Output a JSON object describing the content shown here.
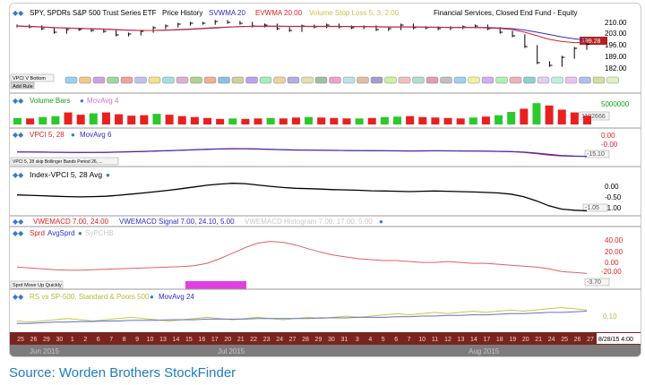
{
  "source_caption": "Source: Worden Brothers StockFinder",
  "panels": {
    "price": {
      "legend": [
        {
          "text": "SPY, SPDRs S&P 500 Trust Series ETF",
          "color": "#000000"
        },
        {
          "text": "Price History",
          "color": "#000000"
        },
        {
          "text": "SVWMA 20",
          "color": "#2b2bd0"
        },
        {
          "text": "EVWMA 20.00",
          "color": "#e02020"
        },
        {
          "text": "Volume Stop Loss 5, 3, 2.00",
          "color": "#e8e060"
        },
        {
          "text": "Financial Services, Closed End Fund - Equity",
          "color": "#000000"
        }
      ],
      "ticks": [
        "210.00",
        "203.00",
        "196.00",
        "189.00",
        "182.00"
      ],
      "last_value": "199.28",
      "small_labels": [
        "VPCI V Bottom",
        "Add Rule"
      ]
    },
    "volume": {
      "legend": [
        {
          "text": "Volume Bars",
          "color": "#16a016"
        },
        {
          "text": "MovAvg 4",
          "color": "#d070d0"
        }
      ],
      "ticks": [
        "5000000"
      ],
      "last_value": "1102666"
    },
    "vpci": {
      "legend": [
        {
          "text": "VPCI 5, 28",
          "color": "#e02020"
        },
        {
          "text": "MovAvg 6",
          "color": "#2b2bd0"
        }
      ],
      "ticks": [
        "0.00",
        "-0.00"
      ],
      "last_value": "-15.10",
      "small_labels": [
        "VPCI 5, 28 skip Bollinger Bands Period 26, ..."
      ]
    },
    "index_vpci": {
      "legend": [
        {
          "text": "Index-VPCI 5, 28 Avg",
          "color": "#000000"
        }
      ],
      "ticks": [
        "0.00",
        "-0.50",
        "-1.00"
      ],
      "last_value": "-1.05"
    },
    "vwemacd": {
      "legend": [
        {
          "text": "VWEMACD 7.00, 24.00",
          "color": "#e02020"
        },
        {
          "text": "VWEMACD Signal 7.00, 24.10, 5.00",
          "color": "#2b2bd0"
        },
        {
          "text": "VWEMACD Histogram 7.00, 17.00, 5.00",
          "color": "#c8c8c8"
        }
      ]
    },
    "sprd": {
      "legend": [
        {
          "text": "Sprd",
          "color": "#e02020"
        },
        {
          "text": "AvgSprd",
          "color": "#2b2bd0"
        },
        {
          "text": "SyPCHB",
          "color": "#c8c8c8"
        }
      ],
      "ticks": [
        "40.00",
        "20.00",
        "0.00",
        "-20.00"
      ],
      "last_value": "-3.70",
      "small_labels": [
        "Sprd Move Up Quickly"
      ]
    },
    "rs": {
      "legend": [
        {
          "text": "RS vs SP-500, Standard & Poors 500",
          "color": "#c8c83a"
        },
        {
          "text": "MovAvg 24",
          "color": "#2b2bd0"
        }
      ],
      "ticks": [
        "0.10"
      ]
    }
  },
  "date_axis": {
    "days": [
      "25",
      "26",
      "29",
      "30",
      "1",
      "2",
      "6",
      "7",
      "8",
      "9",
      "10",
      "13",
      "14",
      "15",
      "16",
      "17",
      "20",
      "21",
      "22",
      "23",
      "24",
      "27",
      "28",
      "29",
      "30",
      "31",
      "3",
      "4",
      "5",
      "6",
      "7",
      "10",
      "11",
      "12",
      "13",
      "14",
      "17",
      "18",
      "19",
      "20",
      "21",
      "24",
      "25",
      "26",
      "27"
    ],
    "months": [
      "Jun 2015",
      "Jul 2015",
      "Aug 2015"
    ],
    "end_label": "8/28/15 4:00"
  },
  "chart_data": [
    {
      "type": "line",
      "title": "SPY, SPDRs S&P 500 Trust Series ETF",
      "series": [
        {
          "name": "Price History",
          "values": [
            209.5,
            209,
            208,
            206,
            207.5,
            207.5,
            207,
            206.5,
            204.5,
            205,
            206.5,
            208.5,
            209.5,
            210.5,
            211,
            211,
            212,
            211.5,
            211,
            209.5,
            210,
            208,
            207,
            209.5,
            209,
            210,
            209,
            208.5,
            209,
            207.5,
            208,
            210,
            208.5,
            208.5,
            208,
            208.5,
            209,
            209.5,
            208,
            206,
            204,
            198,
            189,
            187.5,
            192,
            197,
            199.28
          ]
        },
        {
          "name": "SVWMA 20",
          "values": [
            209.5,
            209.3,
            209,
            208.6,
            208.4,
            208.2,
            208,
            207.8,
            207.5,
            207.2,
            207,
            207,
            207.1,
            207.3,
            207.6,
            208,
            208.4,
            208.8,
            209.1,
            209.3,
            209.4,
            209.4,
            209.3,
            209.3,
            209.3,
            209.3,
            209.3,
            209.2,
            209.2,
            209.1,
            209,
            209,
            209,
            208.9,
            208.8,
            208.7,
            208.7,
            208.7,
            208.6,
            208.4,
            208,
            207.2,
            206,
            204.7,
            203.4,
            202.3,
            201.6
          ]
        },
        {
          "name": "EVWMA 20.00",
          "values": [
            209.4,
            209.2,
            208.9,
            208.5,
            208.3,
            208.1,
            207.9,
            207.7,
            207.4,
            207.1,
            207,
            207,
            207.2,
            207.5,
            207.8,
            208.2,
            208.6,
            208.9,
            209.2,
            209.3,
            209.4,
            209.3,
            209.2,
            209.2,
            209.2,
            209.2,
            209.2,
            209.1,
            209.1,
            209,
            208.9,
            208.9,
            208.9,
            208.8,
            208.7,
            208.6,
            208.6,
            208.6,
            208.4,
            208.1,
            207.5,
            206,
            204,
            202,
            200.8,
            200.2,
            200.3
          ]
        }
      ],
      "ylim": [
        178,
        213
      ]
    },
    {
      "type": "bar",
      "title": "Volume Bars",
      "series": [
        {
          "name": "Volume Bars",
          "values": [
            1.4,
            1.3,
            1.6,
            1.8,
            2.6,
            2.1,
            2.4,
            2.6,
            2.2,
            1.9,
            2.0,
            2.3,
            2.1,
            1.8,
            1.6,
            1.4,
            1.2,
            1.3,
            1.2,
            1.3,
            1.4,
            1.3,
            1.5,
            1.6,
            1.5,
            1.4,
            1.3,
            1.3,
            1.4,
            1.6,
            1.7,
            1.8,
            1.6,
            1.5,
            1.4,
            1.3,
            1.5,
            1.7,
            2.0,
            2.7,
            3.4,
            4.6,
            4.1,
            3.2,
            2.6,
            1.9
          ]
        }
      ],
      "ylim": [
        0,
        6
      ]
    },
    {
      "type": "line",
      "title": "Index-VPCI 5, 28 Avg",
      "series": [
        {
          "name": "Index-VPCI 5, 28 Avg",
          "values": [
            -0.1,
            -0.12,
            -0.15,
            -0.18,
            -0.2,
            -0.22,
            -0.2,
            -0.18,
            -0.12,
            -0.05,
            0.02,
            0.1,
            0.18,
            0.28,
            0.38,
            0.48,
            0.55,
            0.6,
            0.58,
            0.5,
            0.42,
            0.35,
            0.3,
            0.28,
            0.25,
            0.22,
            0.2,
            0.18,
            0.15,
            0.14,
            0.12,
            0.1,
            0.12,
            0.14,
            0.12,
            0.1,
            0.08,
            0.05,
            0.02,
            -0.05,
            -0.2,
            -0.45,
            -0.75,
            -0.95,
            -1.02,
            -1.05
          ]
        }
      ],
      "ylim": [
        -1.3,
        0.8
      ]
    },
    {
      "type": "line",
      "title": "Sprd",
      "series": [
        {
          "name": "Sprd",
          "values": [
            -8,
            -10,
            -12,
            -14,
            -15,
            -15,
            -14,
            -13,
            -12,
            -11,
            -10,
            -9,
            -8,
            -7,
            -5,
            0,
            10,
            22,
            34,
            44,
            48,
            46,
            40,
            32,
            24,
            18,
            14,
            10,
            8,
            6,
            6,
            4,
            2,
            2,
            4,
            2,
            0,
            0,
            -2,
            -4,
            -6,
            -8,
            -12,
            -18,
            -20,
            -22
          ]
        }
      ],
      "ylim": [
        -35,
        55
      ]
    },
    {
      "type": "line",
      "title": "RS vs SP-500, Standard & Poors 500",
      "series": [
        {
          "name": "RS vs SP-500, Standard & Poors 500",
          "values": [
            0.05,
            0.04,
            0.05,
            0.06,
            0.07,
            0.06,
            0.05,
            0.06,
            0.07,
            0.08,
            0.07,
            0.06,
            0.05,
            0.06,
            0.07,
            0.08,
            0.07,
            0.06,
            0.07,
            0.08,
            0.07,
            0.06,
            0.07,
            0.08,
            0.07,
            0.08,
            0.09,
            0.08,
            0.09,
            0.1,
            0.11,
            0.1,
            0.11,
            0.12,
            0.11,
            0.12,
            0.13,
            0.12,
            0.13,
            0.14,
            0.13,
            0.14,
            0.15,
            0.16,
            0.15,
            0.14
          ]
        },
        {
          "name": "MovAvg 24",
          "values": [
            0.03,
            0.03,
            0.035,
            0.04,
            0.04,
            0.045,
            0.045,
            0.05,
            0.05,
            0.055,
            0.055,
            0.055,
            0.06,
            0.06,
            0.06,
            0.065,
            0.065,
            0.065,
            0.065,
            0.07,
            0.07,
            0.07,
            0.07,
            0.07,
            0.075,
            0.075,
            0.075,
            0.08,
            0.08,
            0.08,
            0.085,
            0.085,
            0.09,
            0.09,
            0.095,
            0.095,
            0.1,
            0.1,
            0.105,
            0.11,
            0.11,
            0.115,
            0.12,
            0.12,
            0.125,
            0.13
          ]
        }
      ],
      "ylim": [
        -0.02,
        0.2
      ]
    }
  ]
}
